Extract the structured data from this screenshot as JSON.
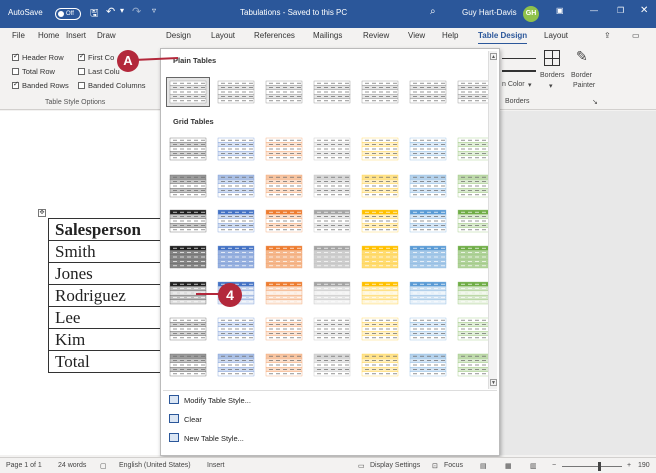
{
  "titlebar": {
    "autosave": "AutoSave",
    "toggle": "Off",
    "title": "Tabulations - Saved to this PC",
    "user": "Guy Hart-Davis",
    "initials": "GH"
  },
  "menu": {
    "tabs": [
      "File",
      "Home",
      "Insert",
      "Draw",
      "Design",
      "Layout",
      "References",
      "Mailings",
      "Review",
      "View",
      "Help",
      "Table Design",
      "Layout"
    ]
  },
  "ribbon": {
    "header_row": "Header Row",
    "first_column": "First Co",
    "total_row": "Total Row",
    "last_column": "Last Colu",
    "banded_rows": "Banded Rows",
    "banded_columns": "Banded Columns",
    "group_label": "Table Style Options",
    "pen_color": "n Color",
    "borders": "Borders",
    "border_painter_1": "Border",
    "border_painter_2": "Painter",
    "borders_group": "Borders"
  },
  "gallery": {
    "plain_label": "Plain Tables",
    "grid_label": "Grid Tables",
    "cmd_modify": "Modify Table Style...",
    "cmd_clear": "Clear",
    "cmd_new": "New Table Style..."
  },
  "colors": {
    "black": "#222222",
    "blue": "#4472c4",
    "orange": "#ed7d31",
    "gray": "#a5a5a5",
    "gold": "#ffc000",
    "lightblue": "#5b9bd5",
    "green": "#70ad47"
  },
  "document": {
    "rows": [
      "Salesperson",
      "Smith",
      "Jones",
      "Rodriguez",
      "Lee",
      "Kim",
      "Total"
    ]
  },
  "callouts": {
    "a": "A",
    "four": "4"
  },
  "status": {
    "page": "Page 1 of 1",
    "words": "24 words",
    "language": "English (United States)",
    "insert": "Insert",
    "display": "Display Settings",
    "focus": "Focus",
    "zoom": "190"
  }
}
